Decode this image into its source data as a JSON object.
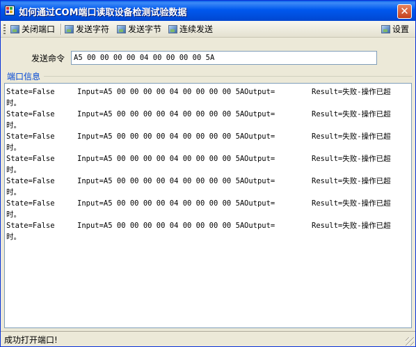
{
  "window": {
    "title": "如何通过COM端口读取设备检测试验数据",
    "close_glyph": "✕"
  },
  "toolbar": {
    "close_port": "关闭端口",
    "send_chars": "发送字符",
    "send_bytes": "发送字节",
    "continuous_send": "连续发送",
    "settings": "设置"
  },
  "command": {
    "label": "发送命令",
    "value": "A5 00 00 00 00 04 00 00 00 00 5A"
  },
  "port_info": {
    "title": "端口信息",
    "entries": [
      {
        "state": "State=False",
        "input": "Input=A5 00 00 00 00 04 00 00 00 00 5A",
        "output": "Output=",
        "result": "Result=失败-操作已超",
        "cont": "时。"
      },
      {
        "state": "State=False",
        "input": "Input=A5 00 00 00 00 04 00 00 00 00 5A",
        "output": "Output=",
        "result": "Result=失败-操作已超",
        "cont": "时。"
      },
      {
        "state": "State=False",
        "input": "Input=A5 00 00 00 00 04 00 00 00 00 5A",
        "output": "Output=",
        "result": "Result=失败-操作已超",
        "cont": "时。"
      },
      {
        "state": "State=False",
        "input": "Input=A5 00 00 00 00 04 00 00 00 00 5A",
        "output": "Output=",
        "result": "Result=失败-操作已超",
        "cont": "时。"
      },
      {
        "state": "State=False",
        "input": "Input=A5 00 00 00 00 04 00 00 00 00 5A",
        "output": "Output=",
        "result": "Result=失败-操作已超",
        "cont": "时。"
      },
      {
        "state": "State=False",
        "input": "Input=A5 00 00 00 00 04 00 00 00 00 5A",
        "output": "Output=",
        "result": "Result=失败-操作已超",
        "cont": "时。"
      },
      {
        "state": "State=False",
        "input": "Input=A5 00 00 00 00 04 00 00 00 00 5A",
        "output": "Output=",
        "result": "Result=失败-操作已超",
        "cont": "时。"
      }
    ]
  },
  "status": {
    "text": "成功打开端口!"
  }
}
